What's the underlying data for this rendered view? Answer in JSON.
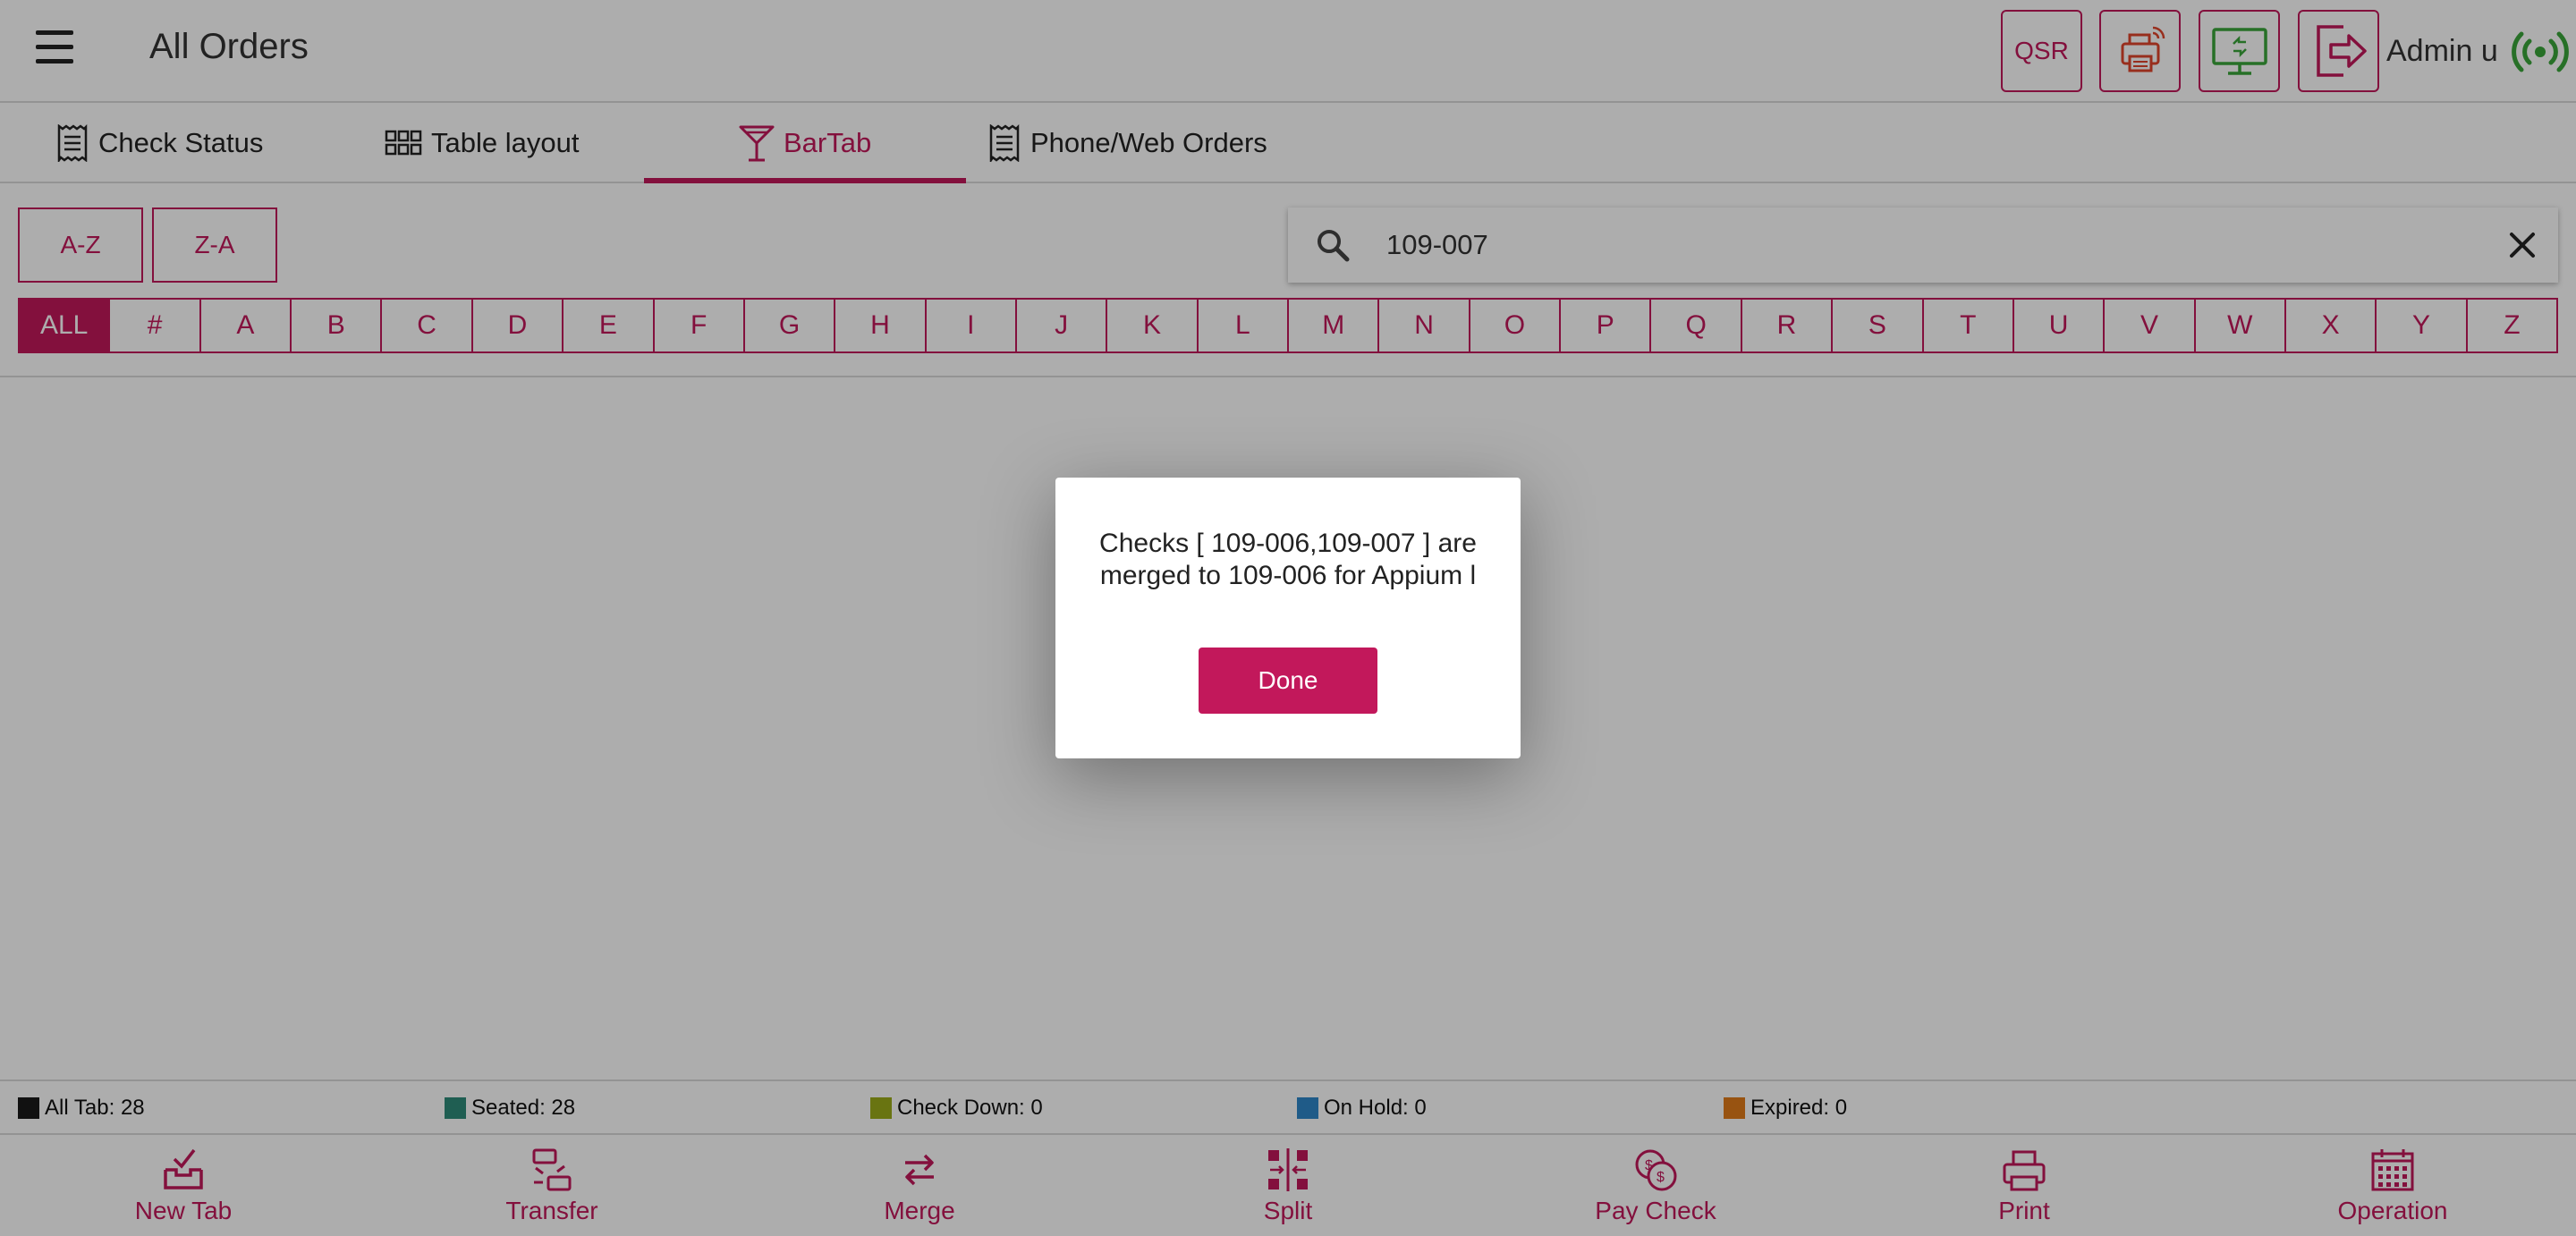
{
  "header": {
    "title": "All Orders",
    "qsr_label": "QSR",
    "admin_name": "Admin u"
  },
  "tabs": [
    {
      "label": "Check Status",
      "icon": "receipt-icon"
    },
    {
      "label": "Table layout",
      "icon": "grid-icon"
    },
    {
      "label": "BarTab",
      "icon": "cocktail-icon",
      "active": true
    },
    {
      "label": "Phone/Web Orders",
      "icon": "receipt-icon"
    }
  ],
  "sort": {
    "az": "A-Z",
    "za": "Z-A"
  },
  "search": {
    "value": "109-007",
    "placeholder": ""
  },
  "alpha_filter": {
    "selected": "ALL",
    "letters": [
      "ALL",
      "#",
      "A",
      "B",
      "C",
      "D",
      "E",
      "F",
      "G",
      "H",
      "I",
      "J",
      "K",
      "L",
      "M",
      "N",
      "O",
      "P",
      "Q",
      "R",
      "S",
      "T",
      "U",
      "V",
      "W",
      "X",
      "Y",
      "Z"
    ]
  },
  "status_bar": [
    {
      "label": "All Tab: 28",
      "color": "#1a1a1a"
    },
    {
      "label": "Seated: 28",
      "color": "#2e8b7a"
    },
    {
      "label": "Check Down: 0",
      "color": "#9bab1a"
    },
    {
      "label": "On Hold: 0",
      "color": "#2f86c9"
    },
    {
      "label": "Expired: 0",
      "color": "#e07b1a"
    }
  ],
  "toolbar": [
    {
      "label": "New Tab",
      "icon": "new-tab-icon"
    },
    {
      "label": "Transfer",
      "icon": "transfer-icon"
    },
    {
      "label": "Merge",
      "icon": "merge-icon"
    },
    {
      "label": "Split",
      "icon": "split-icon"
    },
    {
      "label": "Pay Check",
      "icon": "pay-check-icon"
    },
    {
      "label": "Print",
      "icon": "print-icon"
    },
    {
      "label": "Operation",
      "icon": "calendar-icon"
    }
  ],
  "dialog": {
    "message_line1": "Checks [ 109-006,109-007 ] are",
    "message_line2": "merged to 109-006 for Appium l",
    "done_label": "Done"
  },
  "colors": {
    "accent": "#c2185b",
    "printer_icon": "#e0452b",
    "display_icon": "#3aa63a",
    "signal_icon": "#3aa63a"
  }
}
